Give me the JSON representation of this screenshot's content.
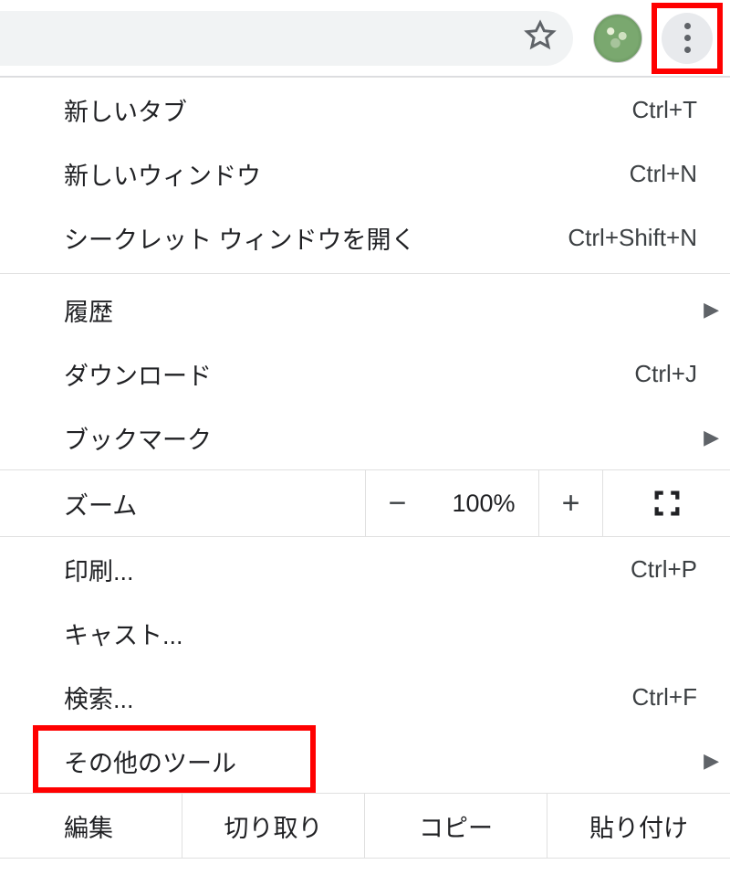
{
  "toolbar": {
    "star_tooltip": "bookmark",
    "avatar_name": "profile",
    "menu_tooltip": "menu"
  },
  "menu": {
    "new_tab": {
      "label": "新しいタブ",
      "shortcut": "Ctrl+T"
    },
    "new_window": {
      "label": "新しいウィンドウ",
      "shortcut": "Ctrl+N"
    },
    "incognito": {
      "label": "シークレット ウィンドウを開く",
      "shortcut": "Ctrl+Shift+N"
    },
    "history": {
      "label": "履歴"
    },
    "downloads": {
      "label": "ダウンロード",
      "shortcut": "Ctrl+J"
    },
    "bookmarks": {
      "label": "ブックマーク"
    },
    "zoom": {
      "label": "ズーム",
      "value": "100%",
      "minus": "−",
      "plus": "+"
    },
    "print": {
      "label": "印刷...",
      "shortcut": "Ctrl+P"
    },
    "cast": {
      "label": "キャスト..."
    },
    "find": {
      "label": "検索...",
      "shortcut": "Ctrl+F"
    },
    "more_tools": {
      "label": "その他のツール"
    },
    "edit": {
      "label": "編集",
      "cut": "切り取り",
      "copy": "コピー",
      "paste": "貼り付け"
    }
  }
}
